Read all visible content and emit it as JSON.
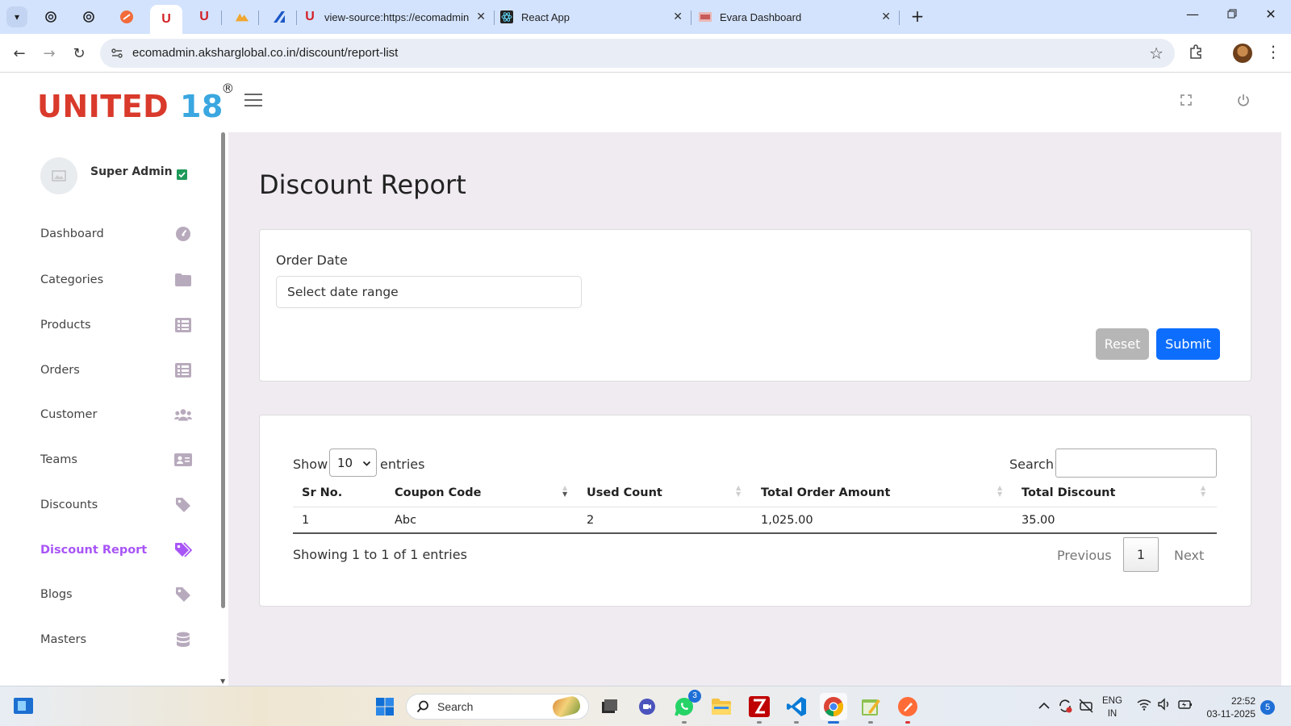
{
  "browser": {
    "tabs": [
      {
        "kind": "pinned",
        "icon": "openai-icon"
      },
      {
        "kind": "pinned",
        "icon": "openai-icon"
      },
      {
        "kind": "pinned",
        "icon": "orange-circle-icon"
      },
      {
        "kind": "pinned",
        "icon": "united-u-icon",
        "active": true
      },
      {
        "kind": "pinned",
        "icon": "united-u-icon"
      },
      {
        "kind": "pinned",
        "icon": "phpmyadmin-icon"
      },
      {
        "kind": "pinned",
        "icon": "blue-arrow-icon"
      },
      {
        "kind": "wide",
        "title": "view-source:https://ecomadmin",
        "icon": "united-u-icon"
      },
      {
        "kind": "wide",
        "title": "React App",
        "icon": "react-icon"
      },
      {
        "kind": "wide",
        "title": "Evara Dashboard",
        "icon": "evara-icon"
      }
    ],
    "url": "ecomadmin.aksharglobal.co.in/discount/report-list"
  },
  "app": {
    "logo_word": "UNITED",
    "logo_number": "18",
    "logo_mark": "®"
  },
  "sidebar": {
    "user_name": "Super Admin",
    "items": [
      {
        "label": "Dashboard",
        "icon": "gauge-icon"
      },
      {
        "label": "Categories",
        "icon": "folder-icon"
      },
      {
        "label": "Products",
        "icon": "list-icon"
      },
      {
        "label": "Orders",
        "icon": "list-icon"
      },
      {
        "label": "Customer",
        "icon": "users-icon"
      },
      {
        "label": "Teams",
        "icon": "id-card-icon"
      },
      {
        "label": "Discounts",
        "icon": "tag-icon"
      },
      {
        "label": "Discount Report",
        "icon": "tags-icon",
        "active": true
      },
      {
        "label": "Blogs",
        "icon": "tag-icon"
      },
      {
        "label": "Masters",
        "icon": "database-icon"
      }
    ]
  },
  "page": {
    "title": "Discount Report",
    "filter": {
      "order_date_label": "Order Date",
      "date_placeholder": "Select date range",
      "reset_label": "Reset",
      "submit_label": "Submit"
    },
    "table": {
      "show_label": "Show",
      "page_size": "10",
      "entries_label": "entries",
      "search_label": "Search:",
      "columns": [
        "Sr No.",
        "Coupon Code",
        "Used Count",
        "Total Order Amount",
        "Total Discount"
      ],
      "rows": [
        [
          "1",
          "Abc",
          "2",
          "1,025.00",
          "35.00"
        ]
      ],
      "info": "Showing 1 to 1 of 1 entries",
      "pagination": {
        "previous": "Previous",
        "current_page": "1",
        "next": "Next"
      }
    }
  },
  "taskbar": {
    "search_label": "Search",
    "whatsapp_badge": "3",
    "lang_line1": "ENG",
    "lang_line2": "IN",
    "time": "22:52",
    "date": "03-11-2025",
    "notifications": "5"
  },
  "colors": {
    "brand_red": "#d93a2b",
    "brand_blue": "#3aa7e0",
    "accent_purple": "#a855f7",
    "primary_blue": "#0d6efd",
    "content_bg": "#efebf1"
  }
}
